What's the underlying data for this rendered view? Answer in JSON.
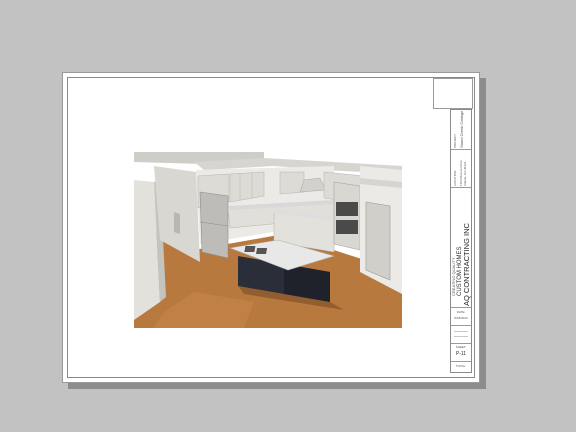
{
  "title_block": {
    "project_label": "PROJECT:",
    "project_name": "Stand Creek Cottage",
    "location_label": "LOCATION:",
    "location_line1": "1254 Monroe Drive",
    "location_line2": "Atlanta, GA 30324",
    "company_tagline": "CREATING QUALITY",
    "company_line": "CUSTOM HOMES",
    "company_name": "AQ CONTRACTING INC",
    "date_label": "DATE:",
    "date_value": "8/18/2023",
    "sheet_label": "SHEET:",
    "sheet_number": "P-11",
    "total_label": "TOTAL:"
  },
  "colors": {
    "background": "#c2c2c2",
    "floor": "#b8793f",
    "cabinet": "#e4e3df",
    "island": "#2a2e38",
    "counter": "#e8e8e8"
  }
}
